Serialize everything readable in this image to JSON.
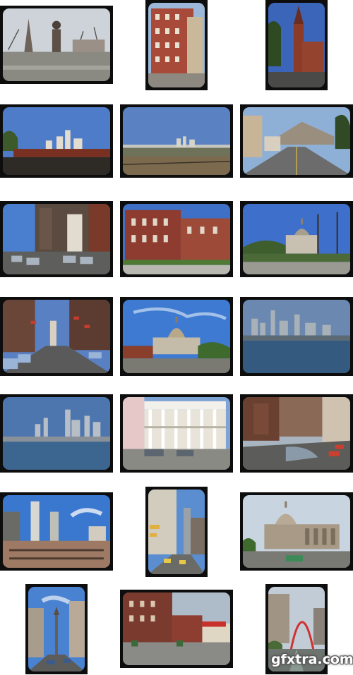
{
  "gallery": {
    "columns": 3,
    "rows": 7,
    "slide_count": 21,
    "slides": [
      {
        "subject": "monument-square-winter"
      },
      {
        "subject": "red-brick-building"
      },
      {
        "subject": "church-steeple"
      },
      {
        "subject": "freight-train-skyline"
      },
      {
        "subject": "distant-skyline-field"
      },
      {
        "subject": "boulevard-hills"
      },
      {
        "subject": "busy-street-cars"
      },
      {
        "subject": "brick-rowhouses"
      },
      {
        "subject": "capitol-dome-distant"
      },
      {
        "subject": "downtown-street-flags"
      },
      {
        "subject": "capitol-building"
      },
      {
        "subject": "river-skyline"
      },
      {
        "subject": "harbor-skyline"
      },
      {
        "subject": "columned-mansion"
      },
      {
        "subject": "city-intersection"
      },
      {
        "subject": "skyscrapers-blue-sky"
      },
      {
        "subject": "street-canyon"
      },
      {
        "subject": "domed-courthouse"
      },
      {
        "subject": "monument-circle-street"
      },
      {
        "subject": "brick-storefronts"
      },
      {
        "subject": "arch-street"
      }
    ]
  },
  "watermark": {
    "text": "gfxtra.com"
  },
  "colors": {
    "frame": "#0d0d0d",
    "sky": "#3f6fbf",
    "brick": "#8b3a2c",
    "water": "#3d5f86",
    "road": "#6b6b6b"
  }
}
